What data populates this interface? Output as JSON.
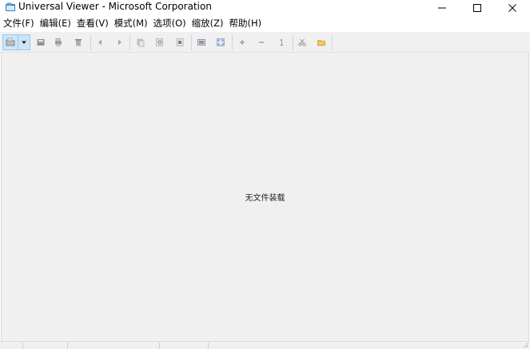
{
  "window": {
    "title": "Universal Viewer - Microsoft Corporation"
  },
  "menu": {
    "items": [
      {
        "label": "文件(F)"
      },
      {
        "label": "编辑(E)"
      },
      {
        "label": "查看(V)"
      },
      {
        "label": "模式(M)"
      },
      {
        "label": "选项(O)"
      },
      {
        "label": "缩放(Z)"
      },
      {
        "label": "帮助(H)"
      }
    ]
  },
  "toolbar": {
    "buttons": [
      {
        "icon": "open-folder-icon",
        "pressed": true
      },
      {
        "icon": "dropdown-arrow-icon"
      },
      {
        "icon": "save-icon"
      },
      {
        "icon": "print-icon"
      },
      {
        "icon": "delete-icon"
      },
      {
        "icon": "back-arrow-icon"
      },
      {
        "icon": "forward-arrow-icon"
      },
      {
        "icon": "copy-icon"
      },
      {
        "icon": "find-icon"
      },
      {
        "icon": "edit-icon"
      },
      {
        "icon": "fit-window-icon"
      },
      {
        "icon": "fullscreen-icon"
      },
      {
        "icon": "zoom-in-icon"
      },
      {
        "icon": "zoom-out-icon"
      },
      {
        "icon": "zoom-reset-icon"
      },
      {
        "icon": "options-icon"
      },
      {
        "icon": "folder-icon"
      }
    ]
  },
  "main": {
    "empty_message": "无文件装载"
  },
  "colors": {
    "toolbar_bg": "#f0f0f0",
    "content_bg": "#f0f0f0",
    "pressed_button_bg": "#cce4f7"
  }
}
